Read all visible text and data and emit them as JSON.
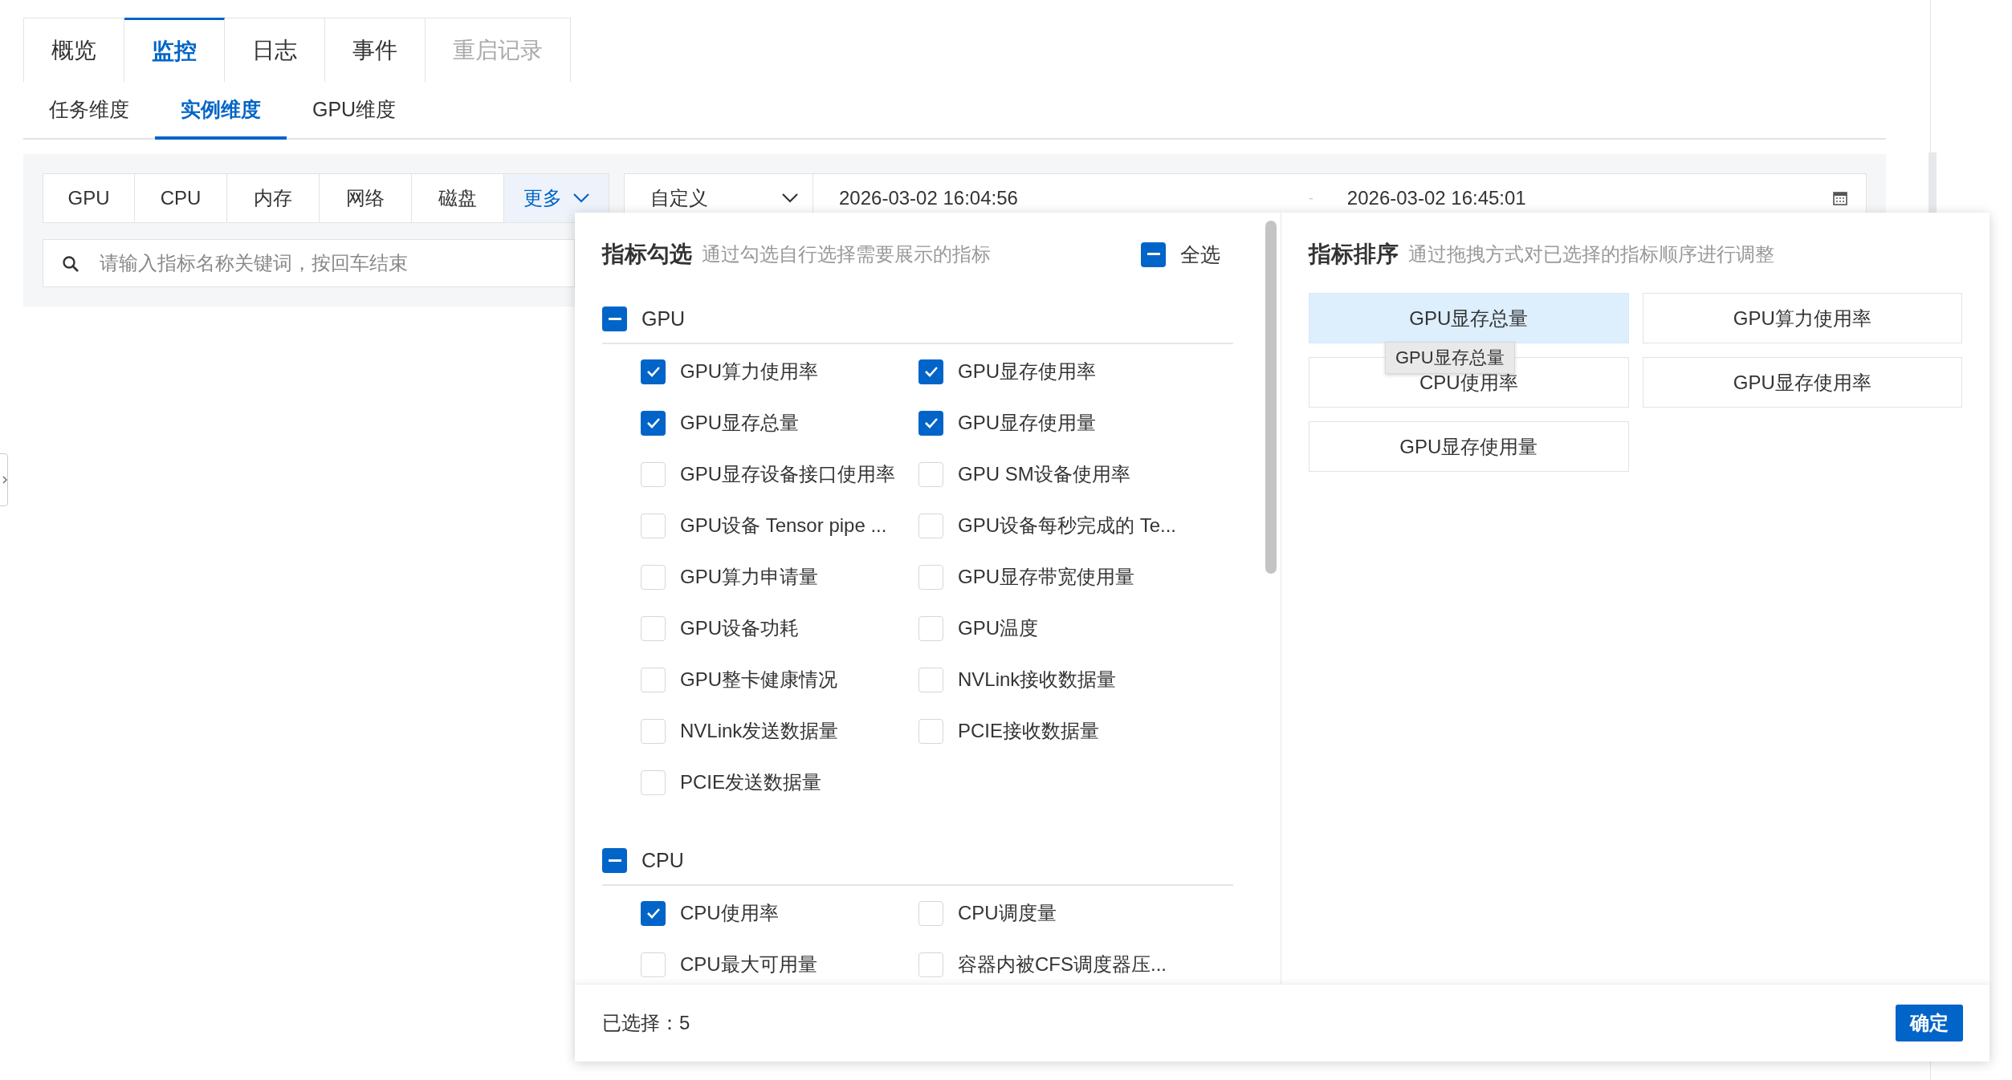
{
  "tabs": [
    {
      "label": "概览",
      "selected": false,
      "disabled": false
    },
    {
      "label": "监控",
      "selected": true,
      "disabled": false
    },
    {
      "label": "日志",
      "selected": false,
      "disabled": false
    },
    {
      "label": "事件",
      "selected": false,
      "disabled": false
    },
    {
      "label": "重启记录",
      "selected": false,
      "disabled": true
    }
  ],
  "sub_tabs": [
    {
      "label": "任务维度",
      "selected": false
    },
    {
      "label": "实例维度",
      "selected": true
    },
    {
      "label": "GPU维度",
      "selected": false
    }
  ],
  "metric_buttons": [
    {
      "label": "GPU",
      "selected": false,
      "kind": "plain"
    },
    {
      "label": "CPU",
      "selected": false,
      "kind": "plain"
    },
    {
      "label": "内存",
      "selected": false,
      "kind": "plain"
    },
    {
      "label": "网络",
      "selected": false,
      "kind": "plain"
    },
    {
      "label": "磁盘",
      "selected": false,
      "kind": "plain"
    },
    {
      "label": "更多",
      "selected": true,
      "kind": "dropdown"
    }
  ],
  "time_range": {
    "preset": "自定义",
    "start": "2026-03-02 16:04:56",
    "separator": "-",
    "end": "2026-03-02 16:45:01"
  },
  "search": {
    "placeholder": "请输入指标名称关键词，按回车结束"
  },
  "metric_picker": {
    "title": "指标勾选",
    "hint": "通过勾选自行选择需要展示的指标",
    "select_all": {
      "label": "全选",
      "indeterminate": true
    },
    "groups": [
      {
        "name": "GPU",
        "indeterminate": true,
        "items": [
          {
            "label": "GPU算力使用率",
            "checked": true
          },
          {
            "label": "GPU显存使用率",
            "checked": true
          },
          {
            "label": "GPU显存总量",
            "checked": true
          },
          {
            "label": "GPU显存使用量",
            "checked": true
          },
          {
            "label": "GPU显存设备接口使用率",
            "checked": false
          },
          {
            "label": "GPU SM设备使用率",
            "checked": false
          },
          {
            "label": "GPU设备 Tensor pipe ...",
            "checked": false
          },
          {
            "label": "GPU设备每秒完成的 Te...",
            "checked": false
          },
          {
            "label": "GPU算力申请量",
            "checked": false
          },
          {
            "label": "GPU显存带宽使用量",
            "checked": false
          },
          {
            "label": "GPU设备功耗",
            "checked": false
          },
          {
            "label": "GPU温度",
            "checked": false
          },
          {
            "label": "GPU整卡健康情况",
            "checked": false
          },
          {
            "label": "NVLink接收数据量",
            "checked": false
          },
          {
            "label": "NVLink发送数据量",
            "checked": false
          },
          {
            "label": "PCIE接收数据量",
            "checked": false
          },
          {
            "label": "PCIE发送数据量",
            "checked": false
          }
        ]
      },
      {
        "name": "CPU",
        "indeterminate": true,
        "items": [
          {
            "label": "CPU使用率",
            "checked": true
          },
          {
            "label": "CPU调度量",
            "checked": false
          },
          {
            "label": "CPU最大可用量",
            "checked": false
          },
          {
            "label": "容器内被CFS调度器压...",
            "checked": false
          }
        ]
      }
    ]
  },
  "metric_order": {
    "title": "指标排序",
    "hint": "通过拖拽方式对已选择的指标顺序进行调整",
    "items": [
      {
        "label": "GPU显存总量",
        "selected": true
      },
      {
        "label": "GPU算力使用率",
        "selected": false
      },
      {
        "label": "CPU使用率",
        "selected": false
      },
      {
        "label": "GPU显存使用率",
        "selected": false
      },
      {
        "label": "GPU显存使用量",
        "selected": false
      }
    ],
    "drag_ghost": "GPU显存总量"
  },
  "footer": {
    "selected_count": "已选择：5",
    "confirm": "确定"
  }
}
